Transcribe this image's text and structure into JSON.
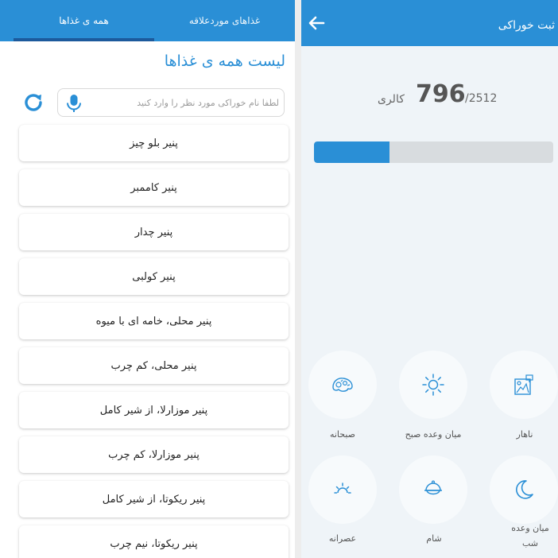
{
  "left_panel": {
    "tabs": [
      {
        "label": "همه ی غذاها",
        "active": true
      },
      {
        "label": "غذاهای موردعلاقه",
        "active": false
      }
    ],
    "list_title": "لیست همه ی غذاها",
    "search": {
      "placeholder": "لطفا نام خوراکی مورد نظر را وارد کنید",
      "value": ""
    },
    "icons": {
      "refresh": "refresh-icon",
      "mic": "microphone-icon"
    },
    "foods": [
      "پنیر بلو چیز",
      "پنیر کاممبر",
      "پنیر چدار",
      "پنیر کولبی",
      "پنیر محلی، خامه ای با میوه",
      "پنیر محلی، کم چرب",
      "پنیر موزارلا، از شیر کامل",
      "پنیر موزارلا، کم چرب",
      "پنیر ریکوتا، از شیر کامل",
      "پنیر ریکوتا، نیم چرب"
    ]
  },
  "right_panel": {
    "title": "ثبت خوراکی",
    "back_icon": "arrow-left-icon",
    "calories": {
      "consumed": "796",
      "total": "/2512",
      "unit": "کالری",
      "progress_fraction": 0.3169
    },
    "meals": [
      {
        "label": "صبحانه",
        "icon": "breakfast-icon"
      },
      {
        "label": "میان وعده صبح",
        "icon": "sun-icon"
      },
      {
        "label": "ناهار",
        "icon": "lunch-icon"
      },
      {
        "label": "عصرانه",
        "icon": "sunset-icon"
      },
      {
        "label": "شام",
        "icon": "dinner-icon"
      },
      {
        "label": "میان وعده شب",
        "icon": "moon-icon"
      }
    ]
  },
  "colors": {
    "primary": "#2a8fd6",
    "tab_indicator": "#1c5a9c",
    "track": "#d8dcdf",
    "background": "#eff4f8"
  }
}
